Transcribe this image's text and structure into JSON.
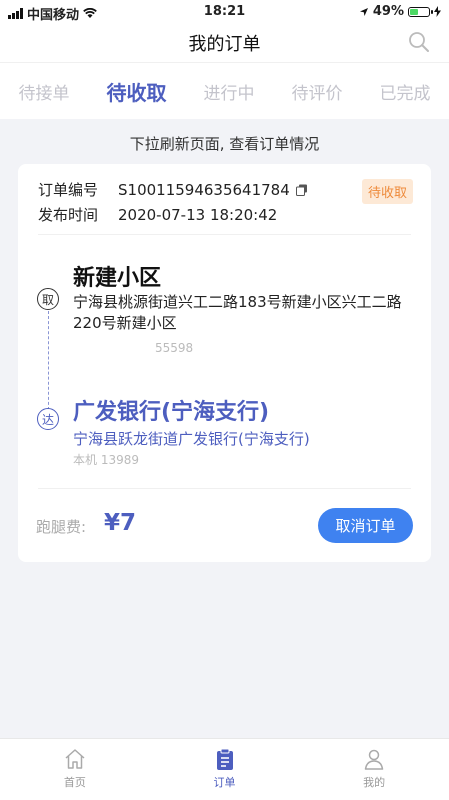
{
  "status": {
    "carrier": "中国移动",
    "time": "18:21",
    "battery": "49%",
    "battery_level": 0.49
  },
  "header": {
    "title": "我的订单"
  },
  "tabs": [
    {
      "label": "待接单",
      "active": false
    },
    {
      "label": "待收取",
      "active": true
    },
    {
      "label": "进行中",
      "active": false
    },
    {
      "label": "待评价",
      "active": false
    },
    {
      "label": "已完成",
      "active": false
    }
  ],
  "refresh_tip": "下拉刷新页面, 查看订单情况",
  "order": {
    "number_label": "订单编号",
    "number": "S10011594635641784",
    "status": "待收取",
    "time_label": "发布时间",
    "time": "2020-07-13 18:20:42",
    "pickup": {
      "marker": "取",
      "name": "新建小区",
      "address": "宁海县桃源街道兴工二路183号新建小区兴工二路220号新建小区",
      "phone": "55598"
    },
    "delivery": {
      "marker": "达",
      "name": "广发银行(宁海支行)",
      "address": "宁海县跃龙街道广发银行(宁海支行)",
      "phone": "本机 13989"
    },
    "fee_label": "跑腿费:",
    "fee": "¥7",
    "cancel_label": "取消订单"
  },
  "tabbar": [
    {
      "label": "首页",
      "icon": "home-icon",
      "active": false
    },
    {
      "label": "订单",
      "icon": "clipboard-icon",
      "active": true
    },
    {
      "label": "我的",
      "icon": "person-icon",
      "active": false
    }
  ],
  "colors": {
    "accent": "#4d5ebf",
    "button": "#3f82f0",
    "badge_bg": "#fde9d6",
    "badge_text": "#ee8b3c"
  }
}
